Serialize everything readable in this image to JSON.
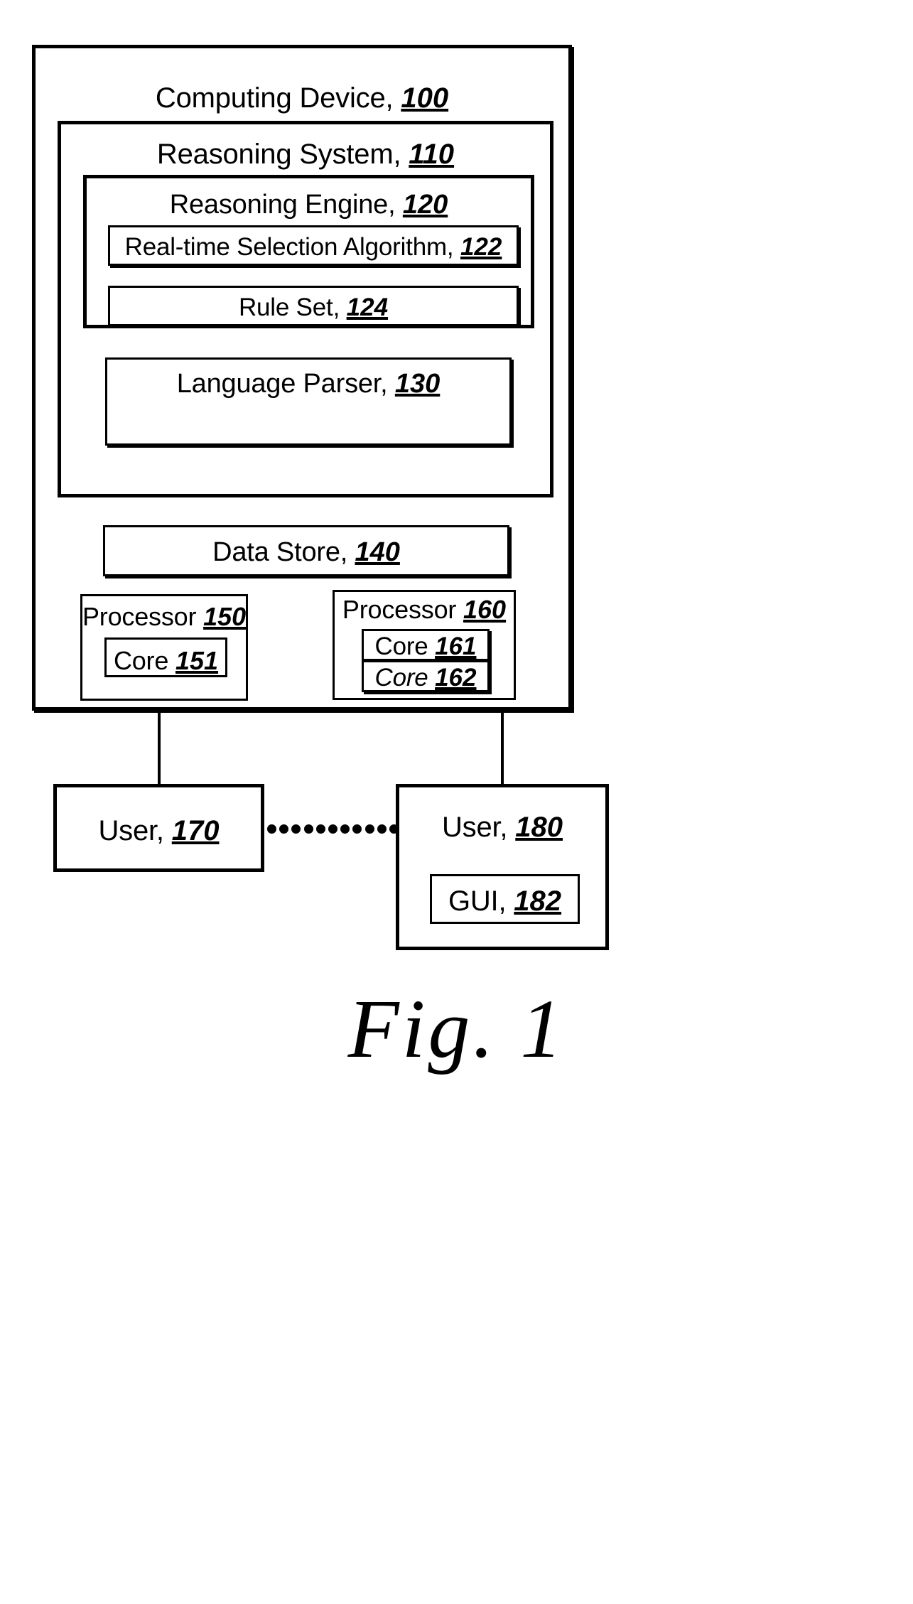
{
  "figure": {
    "caption": "Fig. 1"
  },
  "diagram": {
    "computing_device": {
      "label": "Computing Device,",
      "ref": "100"
    },
    "reasoning_system": {
      "label": "Reasoning System,",
      "ref": "110"
    },
    "reasoning_engine": {
      "label": "Reasoning Engine,",
      "ref": "120"
    },
    "real_time_selection_algorithm": {
      "label": "Real-time Selection Algorithm,",
      "ref": "122"
    },
    "rule_set": {
      "label": "Rule Set,",
      "ref": "124"
    },
    "language_parser": {
      "label": "Language Parser,",
      "ref": "130"
    },
    "data_store": {
      "label": "Data Store,",
      "ref": "140"
    },
    "processor_150": {
      "label": "Processor",
      "ref": "150"
    },
    "core_151": {
      "label": "Core",
      "ref": "151"
    },
    "processor_160": {
      "label": "Processor",
      "ref": "160"
    },
    "core_161": {
      "label": "Core",
      "ref": "161"
    },
    "core_162": {
      "label": "Core",
      "ref": "162"
    },
    "user_170": {
      "label": "User,",
      "ref": "170"
    },
    "user_180": {
      "label": "User,",
      "ref": "180"
    },
    "gui_182": {
      "label": "GUI,",
      "ref": "182"
    },
    "connectors": {
      "dot_count": 11
    }
  }
}
